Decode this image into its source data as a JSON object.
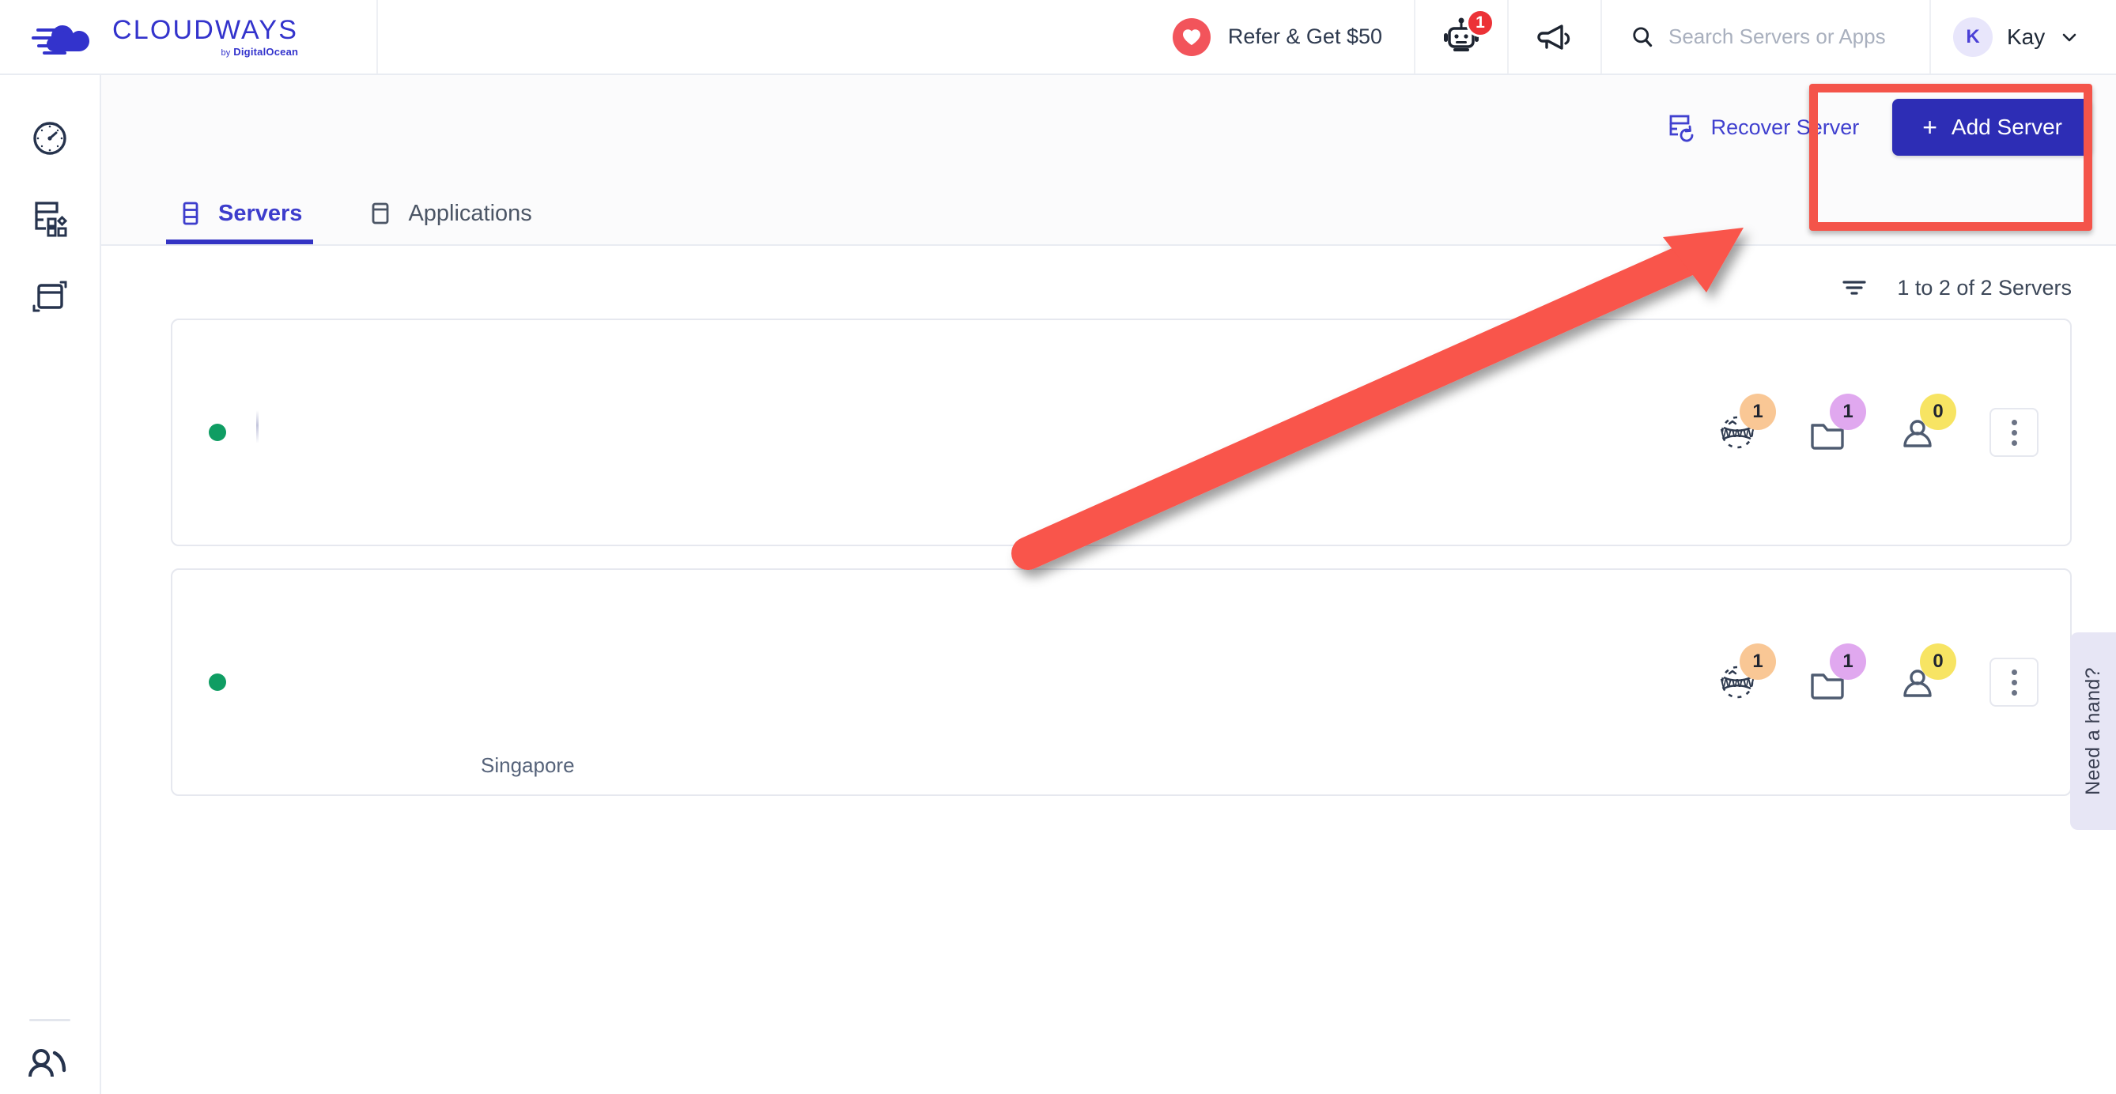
{
  "header": {
    "logo": {
      "word": "CLOUDWAYS",
      "by": "by",
      "parent": "DigitalOcean",
      "icon": "cloudways-logo-icon"
    },
    "refer": {
      "label": "Refer & Get $50",
      "icon": "heart-icon"
    },
    "bot": {
      "icon": "robot-icon",
      "badge": "1"
    },
    "announce": {
      "icon": "megaphone-icon"
    },
    "search": {
      "placeholder": "Search Servers or Apps",
      "value": "",
      "icon": "search-icon"
    },
    "user": {
      "initial": "K",
      "name": "Kay",
      "icon": "chevron-down-icon"
    }
  },
  "rail": {
    "items": [
      {
        "name": "dashboard",
        "icon": "gauge-icon"
      },
      {
        "name": "servers",
        "icon": "server-grid-icon"
      },
      {
        "name": "applications",
        "icon": "window-icon"
      }
    ],
    "bottom": {
      "name": "account",
      "icon": "user-account-icon"
    }
  },
  "page": {
    "recover_label": "Recover Server",
    "recover_icon": "server-recover-icon",
    "add_label": "Add Server",
    "add_plus": "+",
    "tabs": [
      {
        "label": "Servers",
        "icon": "server-stack-icon",
        "active": true
      },
      {
        "label": "Applications",
        "icon": "app-window-icon",
        "active": false
      }
    ],
    "filter_icon": "filter-icon",
    "count_label": "1 to 2 of 2 Servers"
  },
  "servers": [
    {
      "status": "online",
      "name": "",
      "region": "",
      "stats": [
        {
          "name": "applications",
          "icon": "www-globe-icon",
          "value": "1",
          "color": "#f9c795"
        },
        {
          "name": "folders",
          "icon": "folder-icon",
          "value": "1",
          "color": "#e0a8ef"
        },
        {
          "name": "team-members",
          "icon": "person-icon",
          "value": "0",
          "color": "#f7e463"
        }
      ],
      "menu_icon": "kebab-menu-icon"
    },
    {
      "status": "online",
      "name": "",
      "region": "Singapore",
      "stats": [
        {
          "name": "applications",
          "icon": "www-globe-icon",
          "value": "1",
          "color": "#f9c795"
        },
        {
          "name": "folders",
          "icon": "folder-icon",
          "value": "1",
          "color": "#e0a8ef"
        },
        {
          "name": "team-members",
          "icon": "person-icon",
          "value": "0",
          "color": "#f7e463"
        }
      ],
      "menu_icon": "kebab-menu-icon"
    }
  ],
  "support": {
    "label": "Need a hand?"
  },
  "annotation": {
    "highlight_color": "#f4544a",
    "arrow_color": "#f9544b",
    "target": "Add Server"
  },
  "colors": {
    "brand_blue": "#3333cc",
    "button_blue": "#2d2db5",
    "status_green": "#0f9d63",
    "badge_red": "#ec3237",
    "heart_red": "#f2545b"
  }
}
